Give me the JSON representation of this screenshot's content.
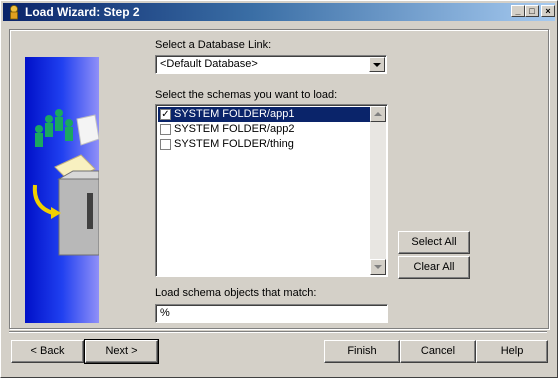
{
  "window": {
    "title": "Load Wizard: Step 2",
    "controls": [
      "minimize-icon",
      "maximize-icon",
      "close-icon"
    ]
  },
  "database_link": {
    "label": "Select a Database Link:",
    "selected": "<Default Database>"
  },
  "schemas": {
    "label": "Select the schemas you want to load:",
    "items": [
      {
        "label": "SYSTEM FOLDER/app1",
        "checked": true,
        "selected": true
      },
      {
        "label": "SYSTEM FOLDER/app2",
        "checked": false,
        "selected": false
      },
      {
        "label": "SYSTEM FOLDER/thing",
        "checked": false,
        "selected": false
      }
    ]
  },
  "side_buttons": {
    "select_all": "Select All",
    "clear_all": "Clear All"
  },
  "filter": {
    "label": "Load schema objects that match:",
    "value": "%"
  },
  "footer": {
    "back": "< Back",
    "next": "Next >",
    "finish": "Finish",
    "cancel": "Cancel",
    "help": "Help"
  },
  "colors": {
    "title_bar": "#0a246a",
    "selection": "#0a246a",
    "art_panel": "#2040f0"
  }
}
